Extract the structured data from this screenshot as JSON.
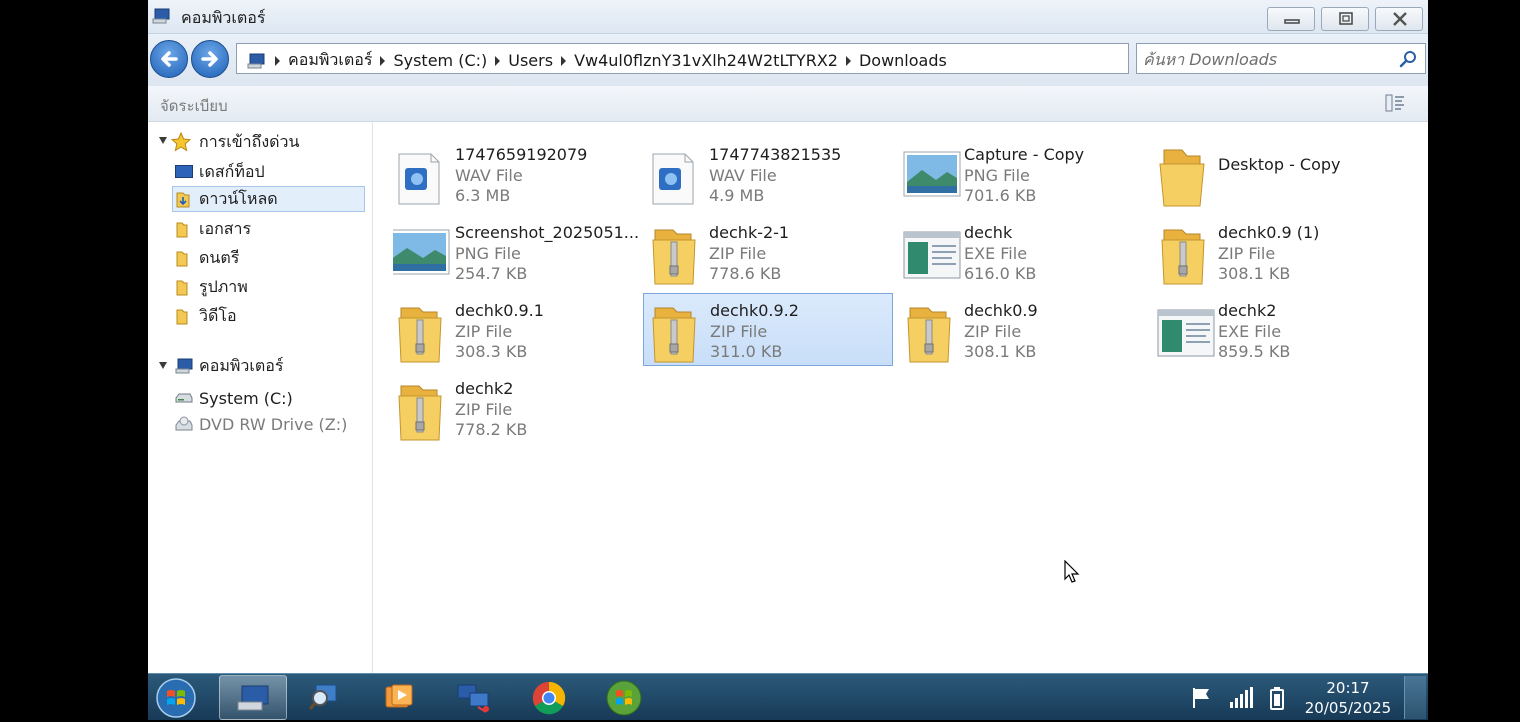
{
  "window": {
    "title": "คอมพิวเตอร์",
    "minimize_icon": "minimize-icon",
    "maximize_icon": "maximize-icon",
    "close_icon": "close-icon"
  },
  "address": {
    "crumbs": [
      "คอมพิวเตอร์",
      "System (C:)",
      "Users",
      "Vw4ul0flznY31vXlh24W2tLTYRX2",
      "Downloads"
    ],
    "search_placeholder": "ค้นหา Downloads"
  },
  "toolbar": {
    "organize_label": "จัดระเบียบ"
  },
  "sidebar": {
    "quick_access": {
      "label": "การเข้าถึงด่วน",
      "items": [
        {
          "label": "เดสก์ท็อป",
          "icon": "desktop-icon"
        },
        {
          "label": "ดาวน์โหลด",
          "icon": "downloads-icon",
          "selected": true
        },
        {
          "label": "เอกสาร",
          "icon": "documents-icon"
        },
        {
          "label": "ดนตรี",
          "icon": "music-icon"
        },
        {
          "label": "รูปภาพ",
          "icon": "pictures-icon"
        },
        {
          "label": "วิดีโอ",
          "icon": "videos-icon"
        }
      ]
    },
    "computer": {
      "label": "คอมพิวเตอร์",
      "items": [
        {
          "label": "System (C:)",
          "icon": "drive-icon"
        },
        {
          "label": "DVD RW Drive (Z:)",
          "icon": "dvd-drive-icon"
        }
      ]
    }
  },
  "files": [
    {
      "name": "1747659192079",
      "type": "WAV File",
      "size": "6.3 MB",
      "icon": "audio-file-icon"
    },
    {
      "name": "1747743821535",
      "type": "WAV File",
      "size": "4.9 MB",
      "icon": "audio-file-icon"
    },
    {
      "name": "Capture - Copy",
      "type": "PNG File",
      "size": "701.6 KB",
      "icon": "image-file-icon"
    },
    {
      "name": "Desktop - Copy",
      "type": "",
      "size": "",
      "icon": "folder-icon"
    },
    {
      "name": "Screenshot_2025051...",
      "type": "PNG File",
      "size": "254.7 KB",
      "icon": "image-file-icon"
    },
    {
      "name": "dechk-2-1",
      "type": "ZIP File",
      "size": "778.6 KB",
      "icon": "zip-folder-icon"
    },
    {
      "name": "dechk",
      "type": "EXE File",
      "size": "616.0 KB",
      "icon": "exe-file-icon"
    },
    {
      "name": "dechk0.9 (1)",
      "type": "ZIP File",
      "size": "308.1 KB",
      "icon": "zip-folder-icon"
    },
    {
      "name": "dechk0.9.1",
      "type": "ZIP File",
      "size": "308.3 KB",
      "icon": "zip-folder-icon"
    },
    {
      "name": "dechk0.9.2",
      "type": "ZIP File",
      "size": "311.0 KB",
      "icon": "zip-folder-icon",
      "selected": true
    },
    {
      "name": "dechk0.9",
      "type": "ZIP File",
      "size": "308.1 KB",
      "icon": "zip-folder-icon"
    },
    {
      "name": "dechk2",
      "type": "EXE File",
      "size": "859.5 KB",
      "icon": "exe-file-icon"
    },
    {
      "name": "dechk2",
      "type": "ZIP File",
      "size": "778.2 KB",
      "icon": "zip-folder-icon"
    }
  ],
  "taskbar": {
    "apps": [
      {
        "icon": "explorer-computer-icon",
        "active": true
      },
      {
        "icon": "search-magnifier-icon"
      },
      {
        "icon": "media-player-icon"
      },
      {
        "icon": "network-computers-icon"
      },
      {
        "icon": "chrome-icon"
      },
      {
        "icon": "windows-orb-app-icon"
      }
    ],
    "tray": [
      "flag-icon",
      "signal-icon",
      "battery-icon"
    ],
    "time": "20:17",
    "date": "20/05/2025"
  },
  "colors": {
    "selection_fill": "#cce0f8",
    "selection_border": "#7ea8dc",
    "taskbar": "#1f4866",
    "folder_yellow": "#f3c853"
  }
}
